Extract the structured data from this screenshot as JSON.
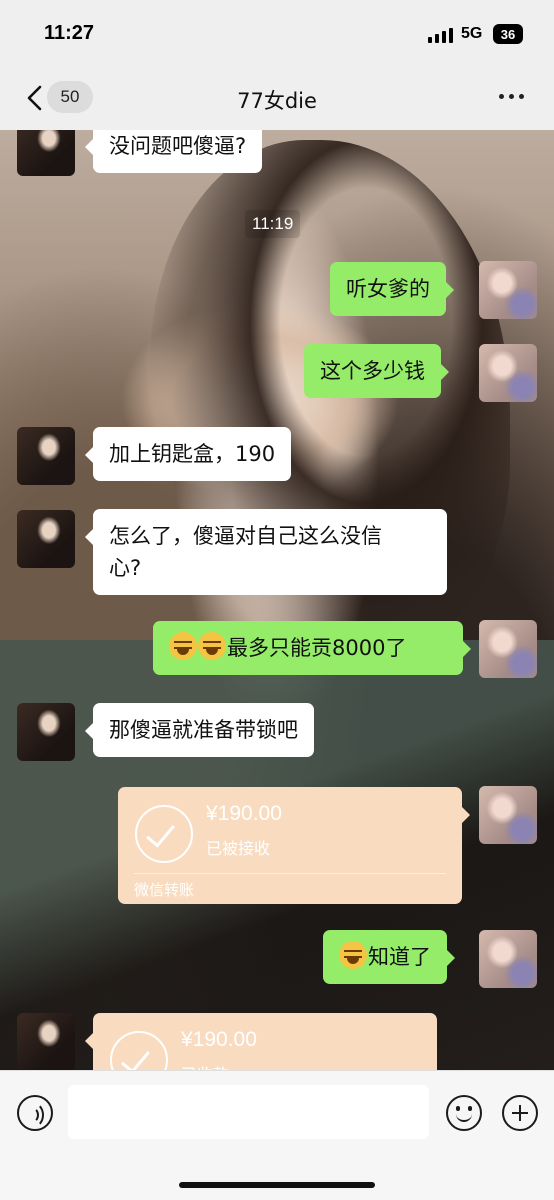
{
  "status_bar": {
    "time": "11:27",
    "network": "5G",
    "battery": "36"
  },
  "header": {
    "unread_count": "50",
    "title": "77女die"
  },
  "messages": [
    {
      "side": "left",
      "text": "没问题吧傻逼?"
    },
    {
      "type": "timestamp",
      "text": "11:19"
    },
    {
      "side": "right",
      "text": "听女爹的"
    },
    {
      "side": "right",
      "text": "这个多少钱"
    },
    {
      "side": "left",
      "text": "加上钥匙盒，190"
    },
    {
      "side": "left",
      "text_line1": "怎么了，傻逼对自己这么没信",
      "text_line2": "心?"
    },
    {
      "side": "right",
      "emoji": "smiling-sweat-emoji",
      "text": "最多只能贡8000了"
    },
    {
      "side": "left",
      "text": "那傻逼就准备带锁吧"
    },
    {
      "side": "right",
      "type": "transfer",
      "amount": "¥190.00",
      "status": "已被接收",
      "brand": "微信转账"
    },
    {
      "side": "right",
      "emoji": "smiling-sweat-emoji",
      "text": "知道了"
    },
    {
      "side": "left",
      "type": "transfer",
      "amount": "¥190.00",
      "status": "已收款"
    }
  ],
  "colors": {
    "self_bubble": "#95ec69",
    "other_bubble": "#ffffff",
    "transfer_card": "#f9dcc0"
  }
}
